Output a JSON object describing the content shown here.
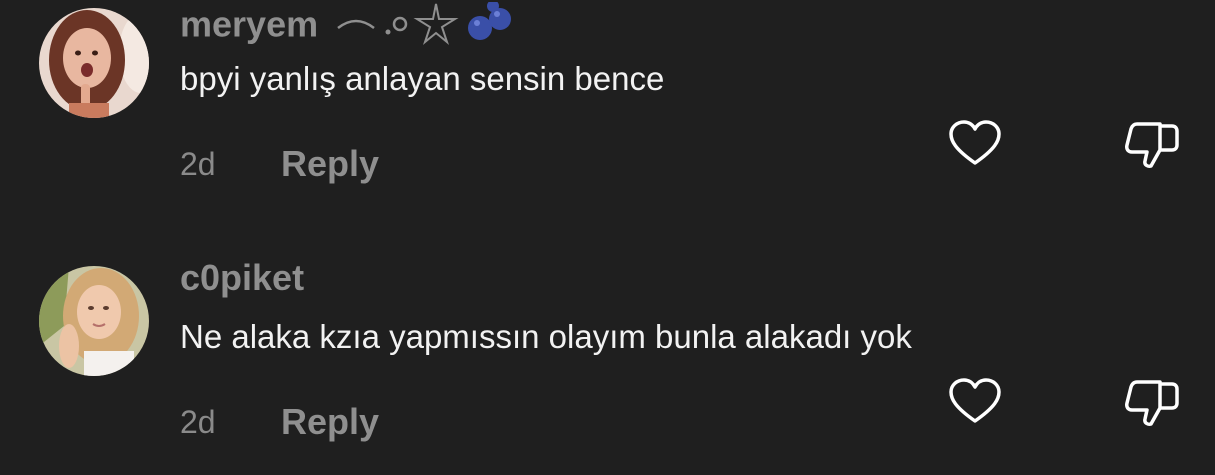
{
  "comments": [
    {
      "username": "meryem",
      "username_decoration": "⁀ .ᐟ ☆ blueberries",
      "text": "bpyi yanlış anlayan sensin bence",
      "time": "2d",
      "reply_label": "Reply",
      "avatar_icon": "avatar-photo"
    },
    {
      "username": "c0piket",
      "text": "Ne alaka kzıa yapmıssın olayım bunla alakadı yok",
      "time": "2d",
      "reply_label": "Reply",
      "avatar_icon": "avatar-photo"
    }
  ],
  "icons": {
    "like": "heart-icon",
    "dislike": "thumbs-down-icon"
  },
  "colors": {
    "background": "#1f1f1f",
    "muted": "#8f8f8f",
    "text": "#f2f2f2",
    "blueberry": "#3a4fa8"
  }
}
